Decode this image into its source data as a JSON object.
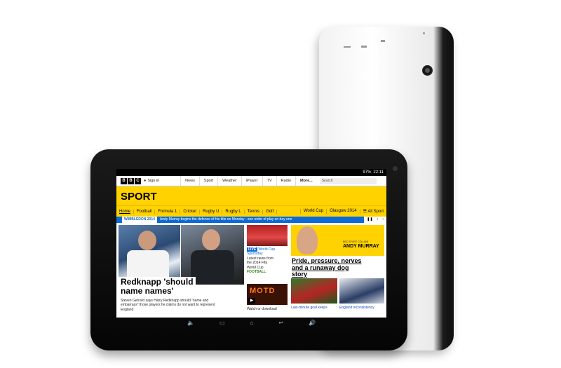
{
  "status": {
    "battery": "97%",
    "time": "22:11"
  },
  "topnav": {
    "logo": [
      "B",
      "B",
      "C"
    ],
    "signin": "Sign in",
    "links": [
      "News",
      "Sport",
      "Weather",
      "iPlayer",
      "TV",
      "Radio",
      "More..."
    ],
    "search_placeholder": "Search"
  },
  "section": {
    "title": "SPORT"
  },
  "sport_nav": {
    "items": [
      "Home",
      "Football",
      "Formula 1",
      "Cricket",
      "Rugby U",
      "Rugby L",
      "Tennis",
      "Golf"
    ],
    "right": [
      "World Cup",
      "Glasgow 2014",
      "All Sport"
    ]
  },
  "ticker": {
    "label": "WIMBLEDON 2014",
    "text": "Andy Murray begins the defence of his title on Monday - see order of play on day one"
  },
  "main_story": {
    "headline_1": "Redknapp 'should",
    "headline_2": "name names'",
    "summary_1": "Steven Gerrard says Harry Redknapp should \"name and",
    "summary_2": "embarrass\" those players he claims do not want to represent",
    "summary_3": "England"
  },
  "live_story": {
    "badge": "LIVE",
    "title_1": "World Cup",
    "title_2": "Sportsday",
    "text_1": "Latest news from",
    "text_2": "the 2014 Fifa",
    "text_3": "World Cup",
    "tag": "FOOTBALL"
  },
  "motd_story": {
    "logo": "MOTD",
    "text": "Watch or download"
  },
  "murray_story": {
    "column_label": "BBC SPORT COLUMN",
    "column_name": "ANDY MURRAY",
    "headline_1": "Pride, pressure, nerves",
    "headline_2": "and a runaway dog",
    "headline_3": "story"
  },
  "bottom_stories": [
    {
      "text": "Last-minute goal keeps"
    },
    {
      "text": "England inconsistency"
    }
  ],
  "colors": {
    "accent_yellow": "#ffd200",
    "ticker_blue": "#0a6ad8"
  }
}
